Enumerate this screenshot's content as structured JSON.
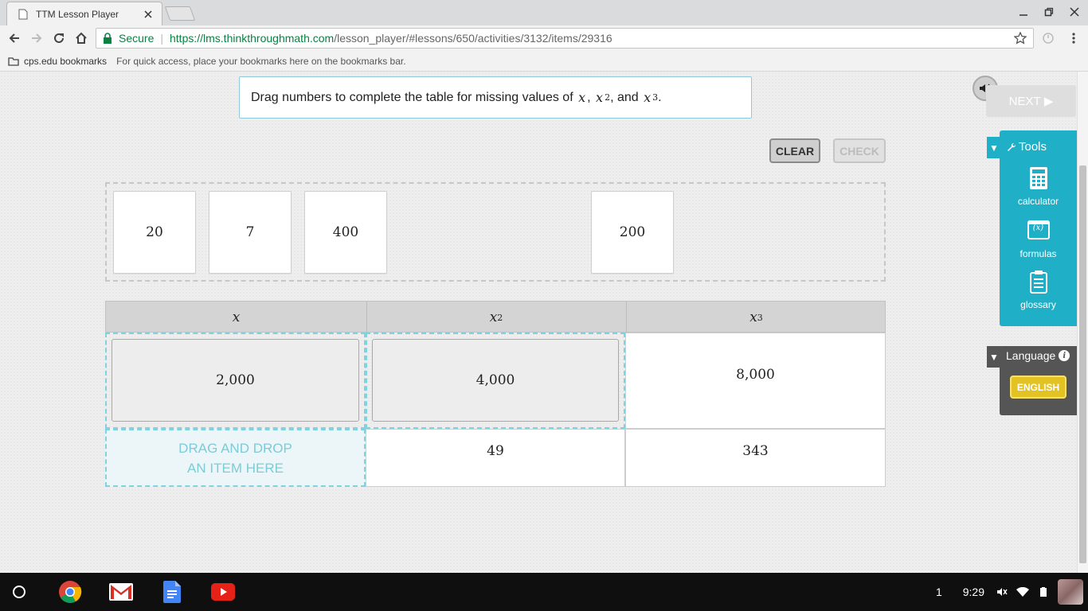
{
  "browser": {
    "tab_title": "TTM Lesson Player",
    "secure_label": "Secure",
    "url_host": "https://lms.thinkthroughmath.com",
    "url_path": "/lesson_player/#lessons/650/activities/3132/items/29316",
    "bookmark_folder": "cps.edu bookmarks",
    "bookmarks_hint": "For quick access, place your bookmarks here on the bookmarks bar."
  },
  "lesson": {
    "prompt_lead": "Drag numbers to complete the table for missing values of",
    "prompt_x": "x",
    "prompt_comma1": ",",
    "prompt_x2": "x",
    "prompt_exp2": "2",
    "prompt_and": ", and",
    "prompt_x3": "x",
    "prompt_exp3": "3",
    "prompt_period": ".",
    "clear_label": "CLEAR",
    "check_label": "CHECK",
    "bank_tiles": [
      "20",
      "7",
      "400",
      "200"
    ],
    "table": {
      "headers": [
        {
          "var": "x",
          "exp": ""
        },
        {
          "var": "x",
          "exp": "2"
        },
        {
          "var": "x",
          "exp": "3"
        }
      ],
      "row1": {
        "placed_x": "2,000",
        "placed_x2": "4,000",
        "x3": "8,000"
      },
      "row2": {
        "drop_line1": "DRAG AND DROP",
        "drop_line2": "AN ITEM HERE",
        "x2": "49",
        "x3": "343"
      }
    }
  },
  "side": {
    "next_label": "NEXT",
    "next_arrow": "▶",
    "tools_label": "Tools",
    "tools": [
      {
        "label": "calculator",
        "icon": "calculator-icon"
      },
      {
        "label": "formulas",
        "icon": "formulas-icon"
      },
      {
        "label": "glossary",
        "icon": "glossary-icon"
      }
    ],
    "formulas_glyph": "(x)",
    "language_label": "Language",
    "language_info": "i",
    "language_button": "ENGLISH"
  },
  "shelf": {
    "badge": "1",
    "time": "9:29"
  },
  "colors": {
    "accent": "#1fb0c8",
    "drop_border": "#7fd3e1",
    "language_btn": "#e3c323",
    "secure_green": "#0b8043"
  }
}
